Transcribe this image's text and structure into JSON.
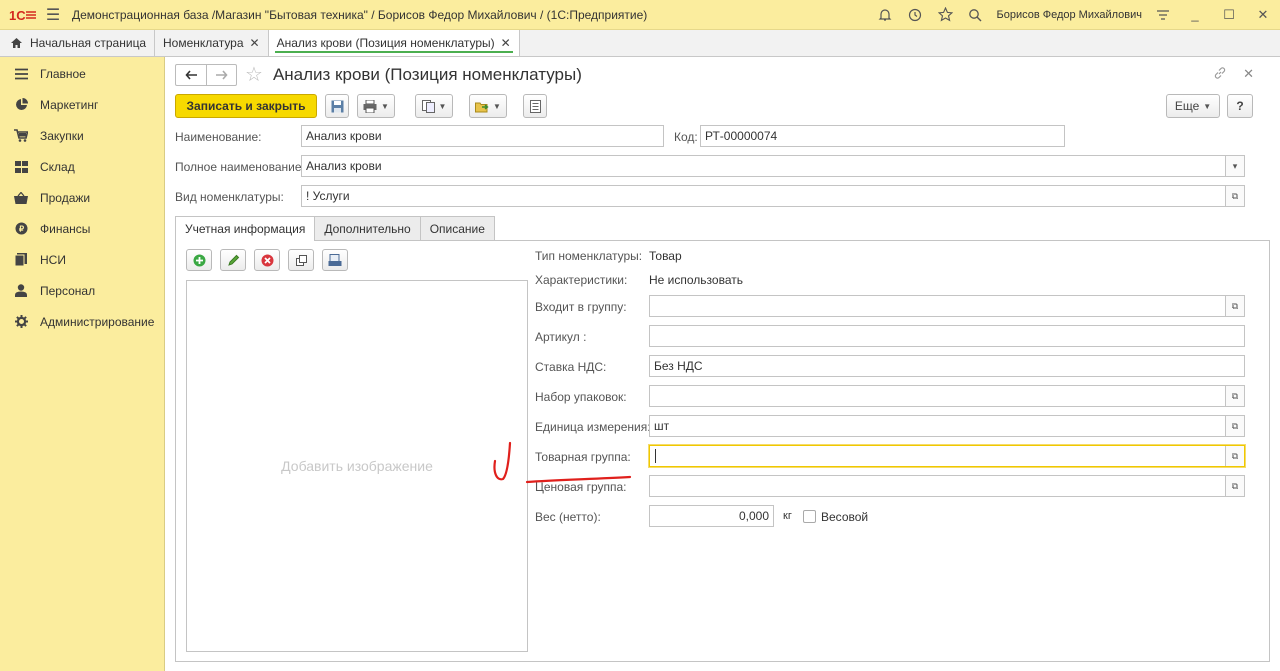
{
  "titlebar": {
    "title": "Демонстрационная база /Магазин \"Бытовая техника\" / Борисов Федор Михайлович /  (1С:Предприятие)",
    "user": "Борисов Федор Михайлович"
  },
  "tabs": {
    "home": "Начальная страница",
    "items": [
      {
        "label": "Номенклатура"
      },
      {
        "label": "Анализ крови (Позиция номенклатуры)"
      }
    ]
  },
  "sidebar": {
    "items": [
      {
        "label": "Главное"
      },
      {
        "label": "Маркетинг"
      },
      {
        "label": "Закупки"
      },
      {
        "label": "Склад"
      },
      {
        "label": "Продажи"
      },
      {
        "label": "Финансы"
      },
      {
        "label": "НСИ"
      },
      {
        "label": "Персонал"
      },
      {
        "label": "Администрирование"
      }
    ]
  },
  "form": {
    "title": "Анализ крови (Позиция номенклатуры)",
    "save_close": "Записать и закрыть",
    "more": "Еще",
    "help": "?",
    "name_label": "Наименование:",
    "name_value": "Анализ крови",
    "code_label": "Код:",
    "code_value": "РТ-00000074",
    "fullname_label": "Полное наименование:",
    "fullname_value": "Анализ крови",
    "kind_label": "Вид номенклатуры:",
    "kind_value": "! Услуги",
    "tabs": [
      "Учетная информация",
      "Дополнительно",
      "Описание"
    ],
    "add_image": "Добавить изображение",
    "props": {
      "type_label": "Тип номенклатуры:",
      "type_value": "Товар",
      "char_label": "Характеристики:",
      "char_value": "Не использовать",
      "group_label": "Входит в группу:",
      "group_value": "",
      "article_label": "Артикул :",
      "article_value": "",
      "vat_label": "Ставка НДС:",
      "vat_value": "Без НДС",
      "pack_label": "Набор упаковок:",
      "pack_value": "",
      "unit_label": "Единица измерения:",
      "unit_value": "шт",
      "goods_group_label": "Товарная группа:",
      "goods_group_value": "",
      "price_group_label": "Ценовая группа:",
      "price_group_value": "",
      "weight_label": "Вес (нетто):",
      "weight_value": "0,000",
      "weight_unit": "кг",
      "weighted_label": "Весовой"
    }
  },
  "colors": {
    "panel_yellow": "#fbed9e",
    "primary_button": "#f7d900",
    "active_tab_underline": "#4caf50",
    "annotation_red": "#e0201c"
  }
}
